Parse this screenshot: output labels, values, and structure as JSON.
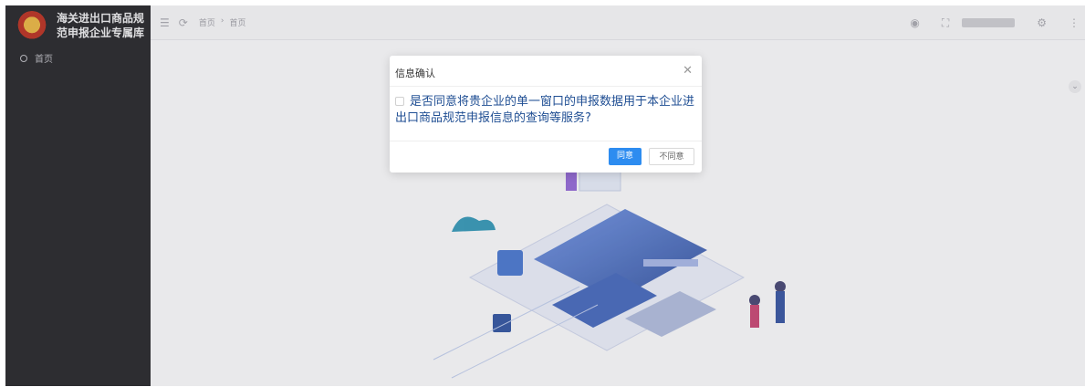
{
  "sidebar": {
    "brand_line1": "海关进出口商品规",
    "brand_line2": "范申报企业专属库",
    "items": [
      {
        "label": "首页",
        "icon": "home-circle-icon"
      }
    ]
  },
  "topbar": {
    "breadcrumb": [
      "首页",
      "首页"
    ],
    "icons": [
      "menu-fold-icon",
      "refresh-icon",
      "lock-icon",
      "fullscreen-icon",
      "settings-icon",
      "more-icon"
    ]
  },
  "modal": {
    "title": "信息确认",
    "message": "是否同意将贵企业的单一窗口的申报数据用于本企业进出口商品规范申报信息的查询等服务?",
    "agree_label": "同意",
    "reject_label": "不同意",
    "close_icon": "close-icon"
  },
  "colors": {
    "sidebar_bg": "#2f2f33",
    "primary_button": "#2d8cf0",
    "message_text": "#1f4e93"
  }
}
